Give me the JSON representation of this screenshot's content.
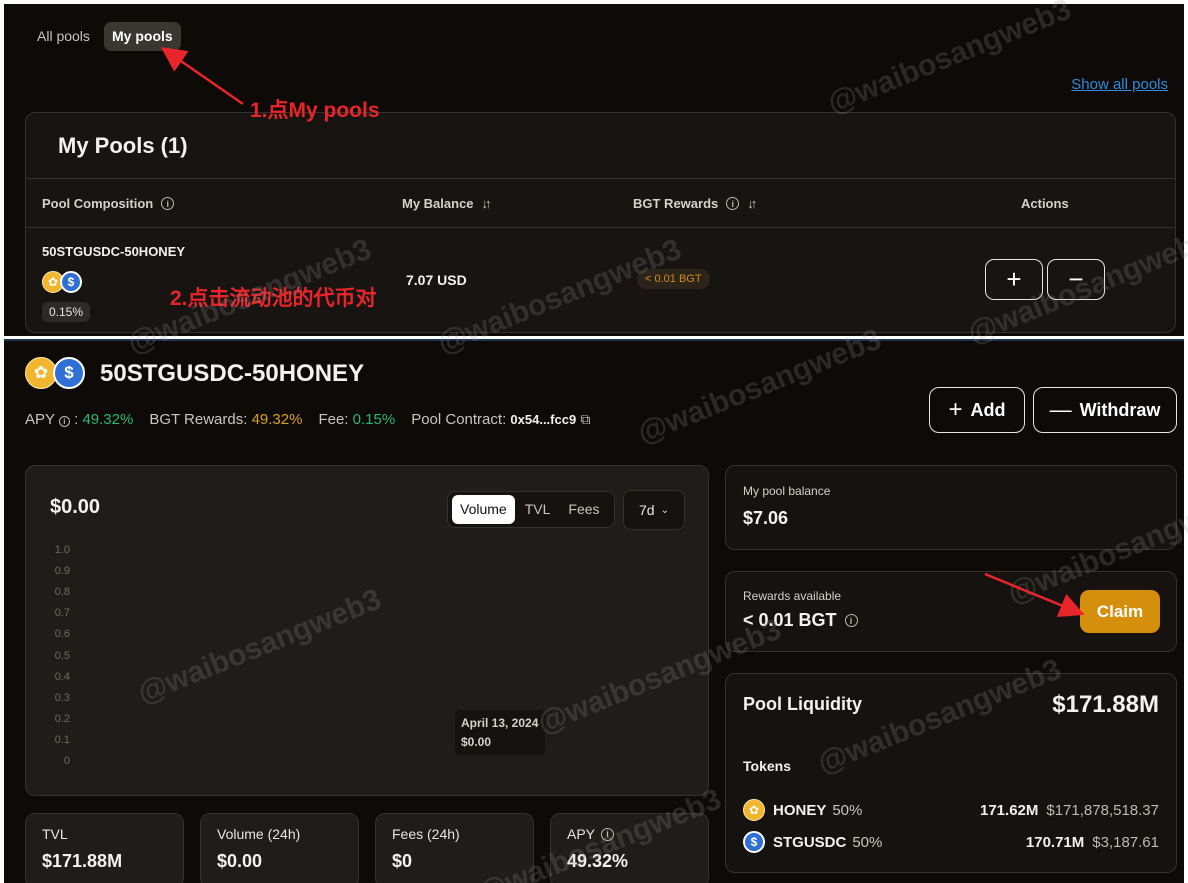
{
  "tabs": {
    "all": "All pools",
    "my": "My pools"
  },
  "show_all": "Show all pools",
  "annotations": {
    "step1": "1.点My pools",
    "step2": "2.点击流动池的代币对"
  },
  "my_pools": {
    "title": "My Pools (1)",
    "columns": {
      "composition": "Pool Composition",
      "balance": "My Balance",
      "rewards": "BGT Rewards",
      "actions": "Actions"
    },
    "row": {
      "name": "50STGUSDC-50HONEY",
      "fee": "0.15%",
      "balance": "7.07 USD",
      "rewards": "< 0.01 BGT",
      "add": "+",
      "remove": "−"
    }
  },
  "pool": {
    "name": "50STGUSDC-50HONEY",
    "apy_label": "APY",
    "apy_sep": ":",
    "apy": "49.32%",
    "bgt_label": "BGT Rewards:",
    "bgt": "49.32%",
    "fee_label": "Fee:",
    "fee": "0.15%",
    "contract_label": "Pool Contract:",
    "contract": "0x54...fcc9",
    "add_label": "Add",
    "withdraw_label": "Withdraw"
  },
  "chart": {
    "value": "$0.00",
    "tabs": [
      "Volume",
      "TVL",
      "Fees"
    ],
    "range": "7d",
    "tooltip_date": "April 13, 2024",
    "tooltip_value": "$0.00"
  },
  "chart_data": {
    "type": "bar",
    "x": [
      "April 13, 2024"
    ],
    "values": [
      0
    ],
    "ylim": [
      0,
      1.0
    ],
    "y_ticks": [
      "1.0",
      "0.9",
      "0.8",
      "0.7",
      "0.6",
      "0.5",
      "0.4",
      "0.3",
      "0.2",
      "0.1",
      "0"
    ],
    "grid": false
  },
  "stats": [
    {
      "label": "TVL",
      "value": "$171.88M"
    },
    {
      "label": "Volume (24h)",
      "value": "$0.00"
    },
    {
      "label": "Fees (24h)",
      "value": "$0"
    },
    {
      "label": "APY",
      "value": "49.32%"
    }
  ],
  "side": {
    "balance_label": "My pool balance",
    "balance": "$7.06",
    "rewards_label": "Rewards available",
    "rewards": "< 0.01 BGT",
    "claim": "Claim",
    "liquidity_label": "Pool Liquidity",
    "liquidity": "$171.88M",
    "tokens_label": "Tokens",
    "tokens": [
      {
        "name": "HONEY",
        "pct": "50%",
        "amount": "171.62M",
        "usd": "$171,878,518.37"
      },
      {
        "name": "STGUSDC",
        "pct": "50%",
        "amount": "170.71M",
        "usd": "$3,187.61"
      }
    ]
  },
  "watermark": "@waibosangweb3",
  "colors": {
    "accent": "#d68e0d",
    "green": "#2bb673",
    "annotation": "#e8252b",
    "link": "#2f8bdc"
  }
}
